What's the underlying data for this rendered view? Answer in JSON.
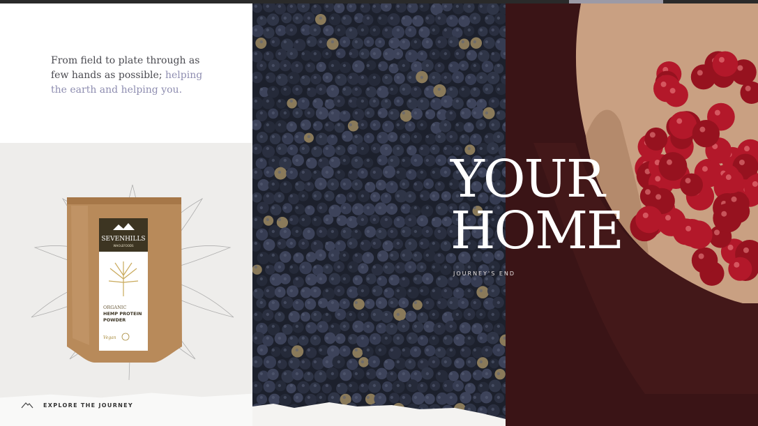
{
  "intro": {
    "text_plain": "From field to plate through as few hands as possible; ",
    "text_highlight": "helping the earth and helping you."
  },
  "product": {
    "brand": "SEVENHILLS",
    "brand_sub": "WHOLEFOODS",
    "line1": "ORGANIC",
    "line2": "HEMP PROTEIN",
    "line3": "POWDER",
    "badge": "Vegan"
  },
  "explore": {
    "label": "EXPLORE THE JOURNEY",
    "icon": "mountain-icon"
  },
  "hero": {
    "line1": "YOUR",
    "line2": "HOME",
    "subtitle": "JOURNEY'S END"
  },
  "colors": {
    "accent": "#8e8db0",
    "berries_bg": "#1f2330",
    "coffee_bg": "#3a1416",
    "cherry": "#b3182a",
    "pouch": "#b88a5a"
  }
}
